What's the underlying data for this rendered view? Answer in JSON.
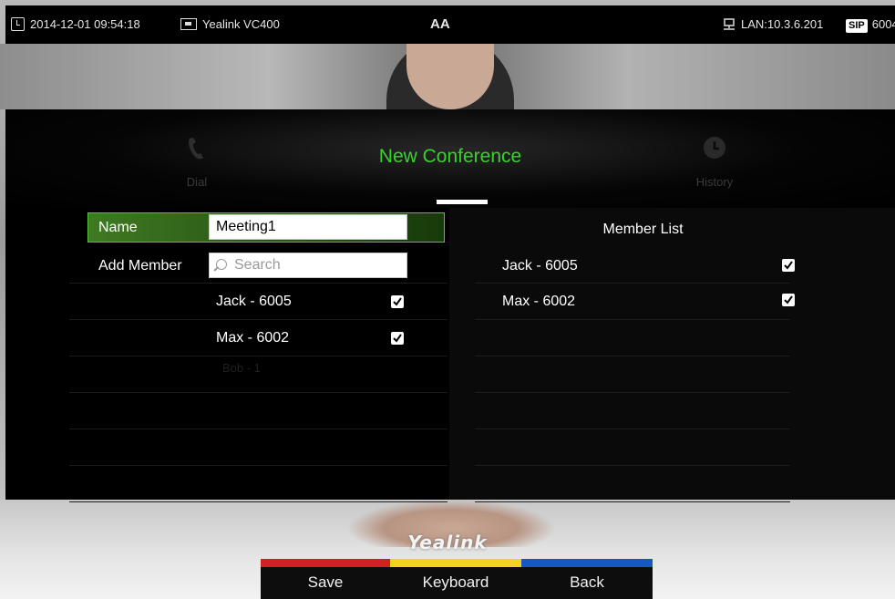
{
  "status_bar": {
    "datetime": "2014-12-01 09:54:18",
    "device": "Yealink VC400",
    "center": "AA",
    "lan": "LAN:10.3.6.201",
    "sip_badge": "SIP",
    "sip_account": "6004"
  },
  "nav": {
    "left_item": "Dial",
    "center_title": "New Conference",
    "right_item": "History"
  },
  "form": {
    "name_label": "Name",
    "name_value": "Meeting1",
    "add_member_label": "Add Member",
    "search_placeholder": "Search",
    "contacts": [
      {
        "label": "Jack - 6005",
        "checked": true
      },
      {
        "label": "Max - 6002",
        "checked": true
      }
    ],
    "faint_row": "Bob - 1"
  },
  "member_list": {
    "header": "Member List",
    "members": [
      {
        "label": "Jack - 6005",
        "checked": true
      },
      {
        "label": "Max - 6002",
        "checked": true
      }
    ]
  },
  "brand": "Yealink",
  "softkeys": [
    {
      "label": "Save",
      "color": "#d31f26"
    },
    {
      "label": "Keyboard",
      "color": "#f2d21a"
    },
    {
      "label": "Back",
      "color": "#1a56c8"
    }
  ],
  "colors": {
    "accent_green": "#39d12f",
    "selection_green": "#3f7a22"
  }
}
